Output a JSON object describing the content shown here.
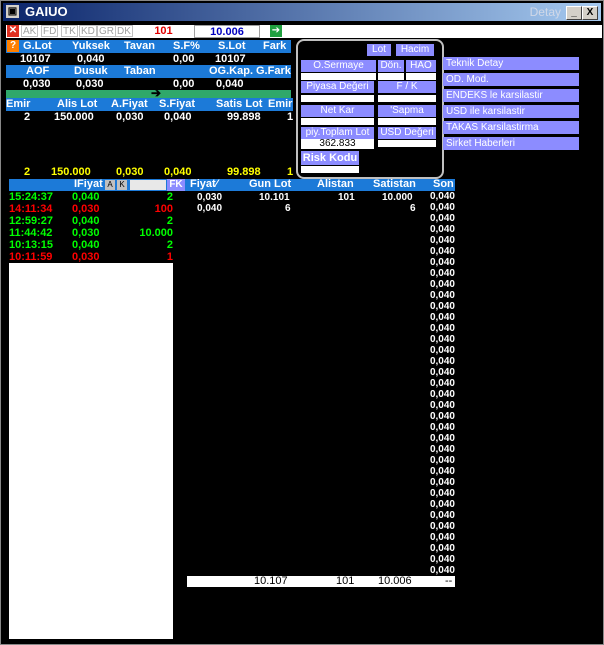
{
  "window": {
    "title": "GAIUO",
    "subtitle": "Detay",
    "min": "_",
    "close": "X"
  },
  "toolbar": {
    "tabs": [
      "AK",
      "FD",
      "TK",
      "KD",
      "GR",
      "DK"
    ],
    "lot": "101",
    "price": "10.006"
  },
  "summary": {
    "row1_headers": [
      "G.Lot",
      "Yuksek",
      "Tavan",
      "S.F%",
      "S.Lot",
      "Fark"
    ],
    "row1_values": [
      "10107",
      "0,040",
      "",
      "0,00",
      "10107",
      ""
    ],
    "row2_headers": [
      "AOF",
      "Dusuk",
      "Taban",
      "OG.Kap.",
      "G.Fark"
    ],
    "row2_values": [
      "0,030",
      "0,030",
      "",
      "0,00",
      "0,040"
    ],
    "arrow": "➔"
  },
  "depth": {
    "headers": [
      "Emir",
      "Alis Lot",
      "A.Fiyat",
      "S.Fiyat",
      "Satis Lot",
      "Emir"
    ],
    "rows": [
      [
        "2",
        "150.000",
        "0,030",
        "0,040",
        "99.898",
        "1"
      ]
    ],
    "totals": [
      "2",
      "150.000",
      "0,030",
      "0,040",
      "99.898",
      "1"
    ]
  },
  "popup": {
    "lot": "Lot",
    "hacim": "Hacim",
    "o_sermaye": "O.Sermaye",
    "don": "Dön.",
    "hao": "HAO",
    "piyasa_degeri": "Piyasa Değeri",
    "fk": "F / K",
    "net_kar": "Net Kar",
    "sapma": "'Sapma",
    "piy_toplam_lot": "piy.Toplam Lot",
    "piy_toplam_val": "362.833",
    "usd_degeri": "USD Değeri",
    "risk_kodu": "Risk Kodu"
  },
  "menu": [
    "Teknik Detay",
    "OD. Mod.",
    "ENDEKS le karsilastir",
    "USD ile karsilastir",
    "TAKAS Karsilastirma",
    "Sirket Haberleri"
  ],
  "trades": {
    "headers": {
      "fiyat": "IFiyat",
      "a": "A",
      "k": "K",
      "fk": "FK"
    },
    "rows": [
      {
        "time": "15:24:37",
        "price": "0,040",
        "qty": "2",
        "color": "#00ff00"
      },
      {
        "time": "14:11:34",
        "price": "0,030",
        "qty": "100",
        "color": "#ff0000"
      },
      {
        "time": "12:59:27",
        "price": "0,040",
        "qty": "2",
        "color": "#00ff00"
      },
      {
        "time": "11:44:42",
        "price": "0,030",
        "qty": "10.000",
        "color": "#00ff00"
      },
      {
        "time": "10:13:15",
        "price": "0,040",
        "qty": "2",
        "color": "#00ff00"
      },
      {
        "time": "10:11:59",
        "price": "0,030",
        "qty": "1",
        "color": "#ff0000"
      }
    ]
  },
  "dist": {
    "headers": [
      "Fiyat",
      "Gun Lot",
      "Alistan",
      "Satistan",
      "Son"
    ],
    "sort_indicator": "⁄",
    "rows": [
      [
        "0,030",
        "10.101",
        "101",
        "10.000"
      ],
      [
        "0,040",
        "6",
        "",
        "6"
      ]
    ],
    "son_value": "0,040",
    "totals": [
      "10.107",
      "101",
      "10.006",
      "--"
    ]
  }
}
